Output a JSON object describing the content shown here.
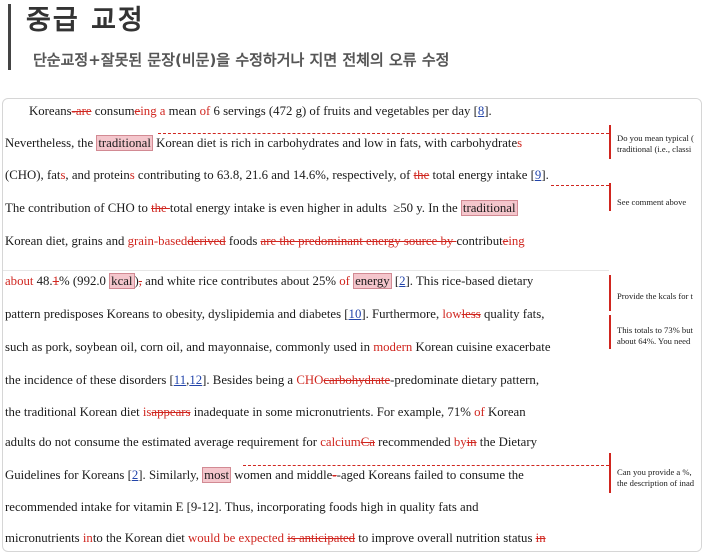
{
  "header": {
    "title": "중급 교정",
    "subtitle": "단순교정+잘못된 문장(비문)을 수정하거나 지면 전체의 오류 수정"
  },
  "document": {
    "lines": [
      "Koreans are consumeing a mean of 6 servings (472 g) of fruits and vegetables per day [8].",
      "Nevertheless, the traditional Korean diet is rich in carbohydrates and low in fats, with carbohydrates",
      "(CHO), fats, and proteins contributing to 63.8, 21.6 and 14.6%, respectively, of the total energy intake [9].",
      "The contribution of CHO to the total energy intake is even higher in adults ≥50 y. In the traditional",
      "Korean diet, grains and grain-basedderived foods are the predominant energy source by contributeing",
      "about 48.1% (992.0 kcal), and white rice contributes about 25% of energy [2]. This rice-based dietary",
      "pattern predisposes Koreans to obesity, dyslipidemia and diabetes [10]. Furthermore, lowless quality fats,",
      "such as pork, soybean oil, corn oil, and mayonnaise, commonly used in modern Korean cuisine exacerbate",
      "the incidence of these disorders [11,12]. Besides being a CHOcarbohydrate-predominate dietary pattern,",
      "the traditional Korean diet isappears inadequate in some micronutrients. For example, 71% of Korean",
      "adults do not consume the estimated average requirement for calciumCa recommended byin the Dietary",
      "Guidelines for Koreans [2]. Similarly, most women and middle--aged Koreans failed to consume the",
      "recommended intake for vitamin E [9-12]. Thus, incorporating foods high in quality fats and",
      "micronutrients into the Korean diet would be expected is anticipated to improve overall nutrition status in"
    ]
  },
  "comments": [
    {
      "line1": "Do you mean typical (",
      "line2": "traditional (i.e., classi"
    },
    {
      "line1": "See comment above",
      "line2": ""
    },
    {
      "line1": "Provide the kcals for t",
      "line2": ""
    },
    {
      "line1": "This totals to 73% but",
      "line2": "about 64%. You need"
    },
    {
      "line1": "Can you provide a %,",
      "line2": "the description of inad"
    }
  ],
  "colors": {
    "revision": "#d0261f",
    "highlight": "#f4c6cc",
    "reference": "#2244aa"
  }
}
